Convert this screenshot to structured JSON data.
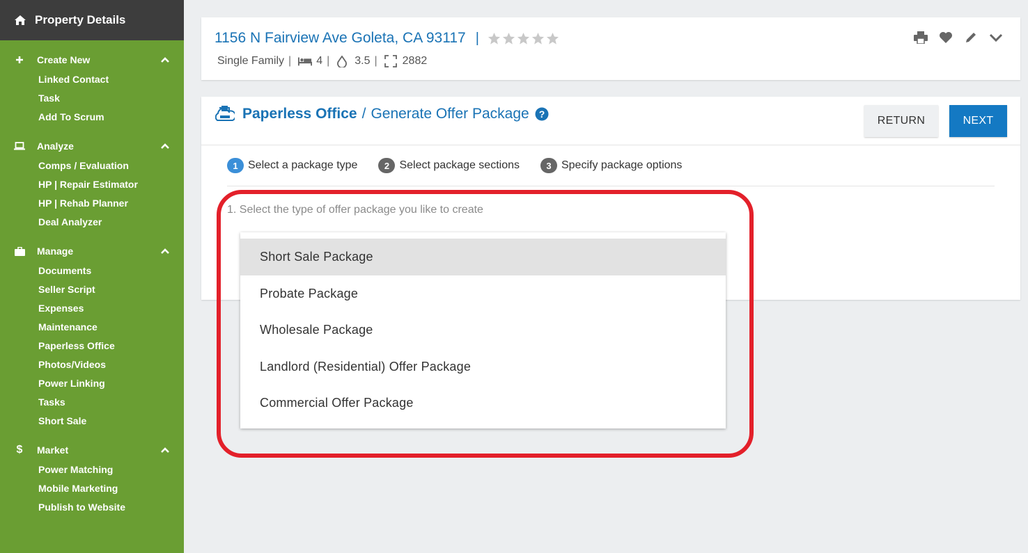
{
  "sidebar": {
    "title": "Property Details",
    "sections": [
      {
        "label": "Create New",
        "icon": "+",
        "items": [
          "Linked Contact",
          "Task",
          "Add To Scrum"
        ]
      },
      {
        "label": "Analyze",
        "icon": "laptop",
        "items": [
          "Comps / Evaluation",
          "HP | Repair Estimator",
          "HP | Rehab Planner",
          "Deal Analyzer"
        ]
      },
      {
        "label": "Manage",
        "icon": "briefcase",
        "items": [
          "Documents",
          "Seller Script",
          "Expenses",
          "Maintenance",
          "Paperless Office",
          "Photos/Videos",
          "Power Linking",
          "Tasks",
          "Short Sale"
        ]
      },
      {
        "label": "Market",
        "icon": "$",
        "items": [
          "Power Matching",
          "Mobile Marketing",
          "Publish to Website"
        ]
      }
    ]
  },
  "property": {
    "address": "1156 N Fairview Ave Goleta, CA 93117",
    "separator": "|",
    "type": "Single Family",
    "beds": "4",
    "baths": "3.5",
    "sqft": "2882",
    "rating_stars": 0,
    "meta_sep": "|"
  },
  "breadcrumb": {
    "strong": "Paperless Office",
    "sep": "/",
    "light": "Generate Offer Package"
  },
  "buttons": {
    "return": "RETURN",
    "next": "NEXT"
  },
  "steps": [
    {
      "num": "1",
      "label": "Select a package type"
    },
    {
      "num": "2",
      "label": "Select package sections"
    },
    {
      "num": "3",
      "label": "Specify package options"
    }
  ],
  "instruction": "1. Select the type of offer package you like to create",
  "options": [
    "Short Sale Package",
    "Probate Package",
    "Wholesale Package",
    "Landlord (Residential) Offer Package",
    "Commercial Offer Package"
  ],
  "colors": {
    "sidebar": "#6a9e33",
    "header": "#3d3d3d",
    "accent": "#1a73b5",
    "next": "#1479c3",
    "highlight": "#e3202a"
  }
}
